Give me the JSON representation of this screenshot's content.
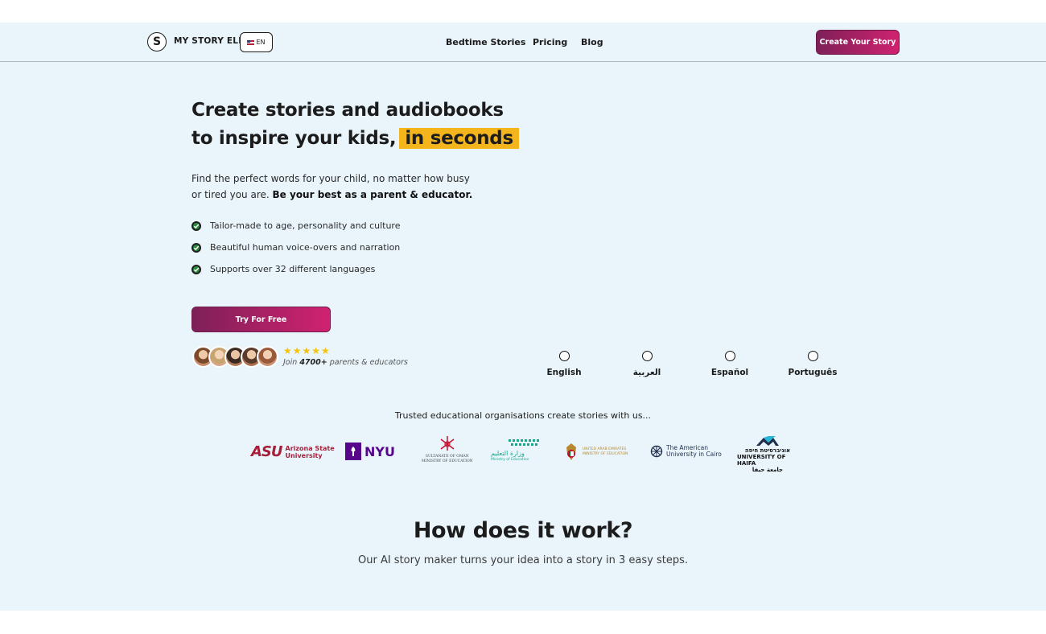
{
  "header": {
    "logo_letter": "S",
    "brand": "MY STORY ELF",
    "language": "EN",
    "nav": [
      "Bedtime Stories",
      "Pricing",
      "Blog"
    ],
    "cta": "Create Your Story"
  },
  "hero": {
    "title_line1": "Create stories and audiobooks",
    "title_line2": "to inspire your kids,",
    "title_highlight": "in seconds",
    "desc": "Find the perfect words for your child, no matter how busy or tired you are.",
    "desc_bold": "Be your best as a parent & educator.",
    "features": [
      "Tailor-made to age, personality and culture",
      "Beautiful human voice-overs and narration",
      "Supports over 32 different languages"
    ],
    "cta": "Try For Free",
    "stars": "★★★★★",
    "join_prefix": "Join",
    "join_count": "4700+",
    "join_suffix": "parents & educators"
  },
  "languages": [
    "English",
    "العربية",
    "Español",
    "Português"
  ],
  "trusted": {
    "heading": "Trusted educational organisations create stories with us...",
    "orgs": [
      {
        "mark": "ASU",
        "name_line1": "Arizona State",
        "name_line2": "University"
      },
      {
        "mark": "NYU"
      },
      {
        "name_line1": "SULTANATE OF OMAN",
        "name_line2": "MINISTRY OF EDUCATION"
      },
      {
        "name_line1": "وزارة التعليم",
        "name_line2": "Ministry of Education"
      },
      {
        "name_line1": "UNITED ARAB EMIRATES",
        "name_line2": "MINISTRY OF EDUCATION"
      },
      {
        "name_line1": "The American",
        "name_line2": "University in Cairo"
      },
      {
        "name_line1": "אוניברסיטת חיפה",
        "name_line2": "UNIVERSITY OF HAIFA",
        "name_line3": "جامعة حيفا"
      }
    ]
  },
  "how": {
    "title": "How does it work?",
    "subtitle": "Our AI story maker turns your idea into a story in 3 easy steps."
  },
  "colors": {
    "background": "#e9f5fb",
    "highlight": "#f3b51b",
    "button_start": "#7e2058",
    "button_end": "#d02270",
    "check": "#2b8a3e",
    "star": "#f5c20b"
  }
}
